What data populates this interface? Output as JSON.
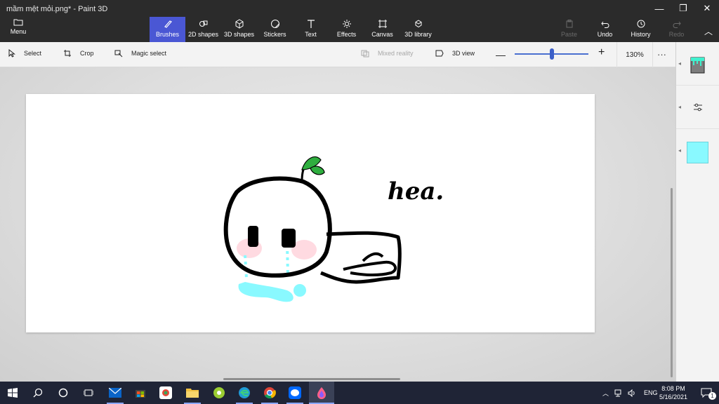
{
  "window": {
    "title": "mầm mệt mỏi.png* - Paint 3D"
  },
  "ribbon": {
    "menu_label": "Menu",
    "tools": [
      {
        "label": "Brushes",
        "icon": "brush-icon",
        "active": true
      },
      {
        "label": "2D shapes",
        "icon": "2d-shapes-icon",
        "active": false
      },
      {
        "label": "3D shapes",
        "icon": "3d-shapes-icon",
        "active": false
      },
      {
        "label": "Stickers",
        "icon": "stickers-icon",
        "active": false
      },
      {
        "label": "Text",
        "icon": "text-icon",
        "active": false
      },
      {
        "label": "Effects",
        "icon": "effects-icon",
        "active": false
      },
      {
        "label": "Canvas",
        "icon": "canvas-icon",
        "active": false
      },
      {
        "label": "3D library",
        "icon": "3d-library-icon",
        "active": false
      }
    ],
    "right_tools": [
      {
        "label": "Paste",
        "icon": "paste-icon",
        "enabled": false
      },
      {
        "label": "Undo",
        "icon": "undo-icon",
        "enabled": true
      },
      {
        "label": "History",
        "icon": "history-icon",
        "enabled": true
      },
      {
        "label": "Redo",
        "icon": "redo-icon",
        "enabled": false
      }
    ]
  },
  "toolbar": {
    "select_label": "Select",
    "crop_label": "Crop",
    "magic_select_label": "Magic select",
    "mixed_reality_label": "Mixed reality",
    "view_3d_label": "3D view",
    "zoom_value": "130%",
    "zoom_level": 0.52
  },
  "side_panel": {
    "brush_color": "#89f9ff"
  },
  "canvas": {
    "handwriting": "hea."
  },
  "taskbar": {
    "language": "ENG",
    "time": "8:08 PM",
    "date": "5/16/2021",
    "notification_count": "1"
  },
  "colors": {
    "ribbon_bg": "#2b2b2b",
    "active_tool": "#4a57d4",
    "leaf_green": "#2fae3f",
    "tear_blue": "#89f9ff",
    "blush_pink": "#ffb7c5"
  }
}
